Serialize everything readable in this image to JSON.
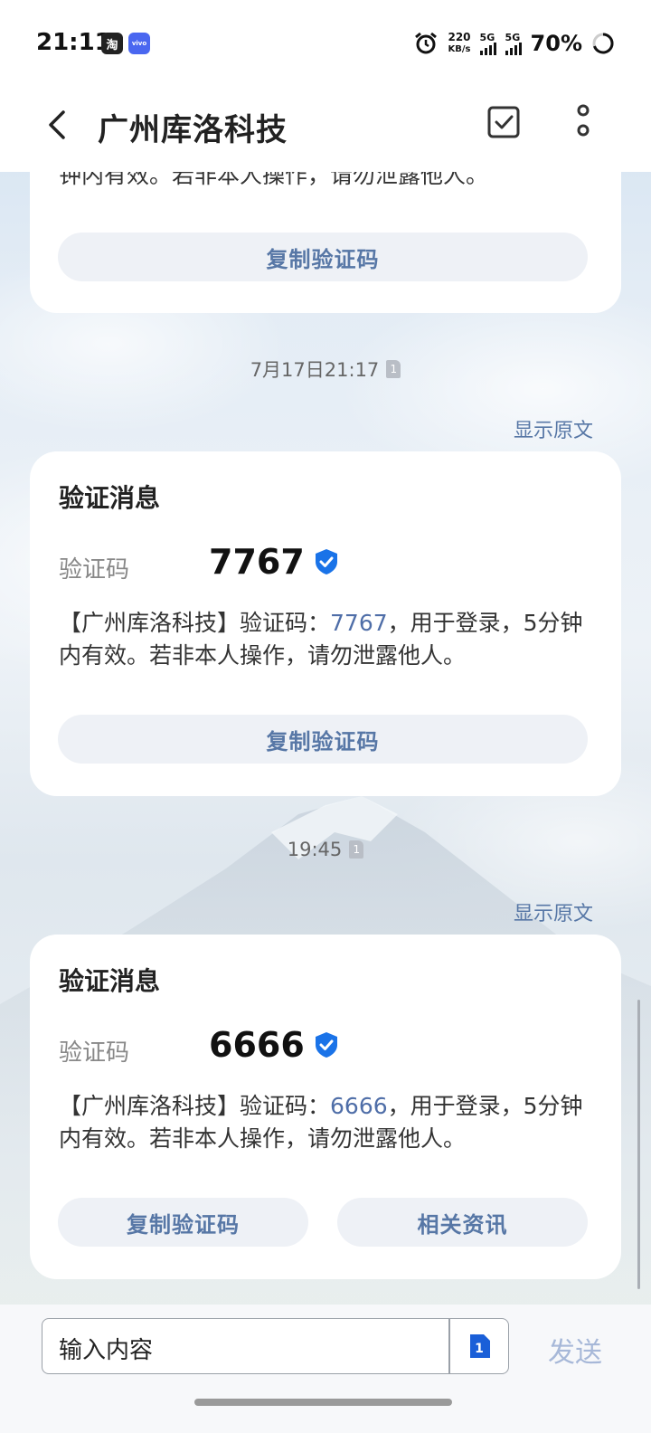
{
  "status_bar": {
    "time": "21:11",
    "app_icons": [
      "淘",
      "vivo"
    ],
    "net_speed_value": "220",
    "net_speed_unit": "KB/s",
    "sim1": "5G",
    "sim2": "5G",
    "battery": "70%"
  },
  "header": {
    "title": "广州库洛科技"
  },
  "messages": [
    {
      "partial_text": "钟内有效。若非本人操作，请勿泄露他人。",
      "copy_button": "复制验证码"
    },
    {
      "timestamp": "7月17日21:17",
      "sim": "1",
      "show_original": "显示原文",
      "card_title": "验证消息",
      "code_label": "验证码",
      "code": "7767",
      "body_pre": "【广州库洛科技】验证码：",
      "body_code": "7767",
      "body_post": "，用于登录，5分钟内有效。若非本人操作，请勿泄露他人。",
      "copy_button": "复制验证码"
    },
    {
      "timestamp": "19:45",
      "sim": "1",
      "show_original": "显示原文",
      "card_title": "验证消息",
      "code_label": "验证码",
      "code": "6666",
      "body_pre": "【广州库洛科技】验证码：",
      "body_code": "6666",
      "body_post": "，用于登录，5分钟内有效。若非本人操作，请勿泄露他人。",
      "copy_button": "复制验证码",
      "info_button": "相关资讯"
    }
  ],
  "composer": {
    "placeholder": "输入内容",
    "sim_badge": "1",
    "send": "发送"
  },
  "colors": {
    "accent": "#5777a6",
    "verified_badge": "#1a73e8",
    "code_highlight": "#4f6ea8"
  }
}
